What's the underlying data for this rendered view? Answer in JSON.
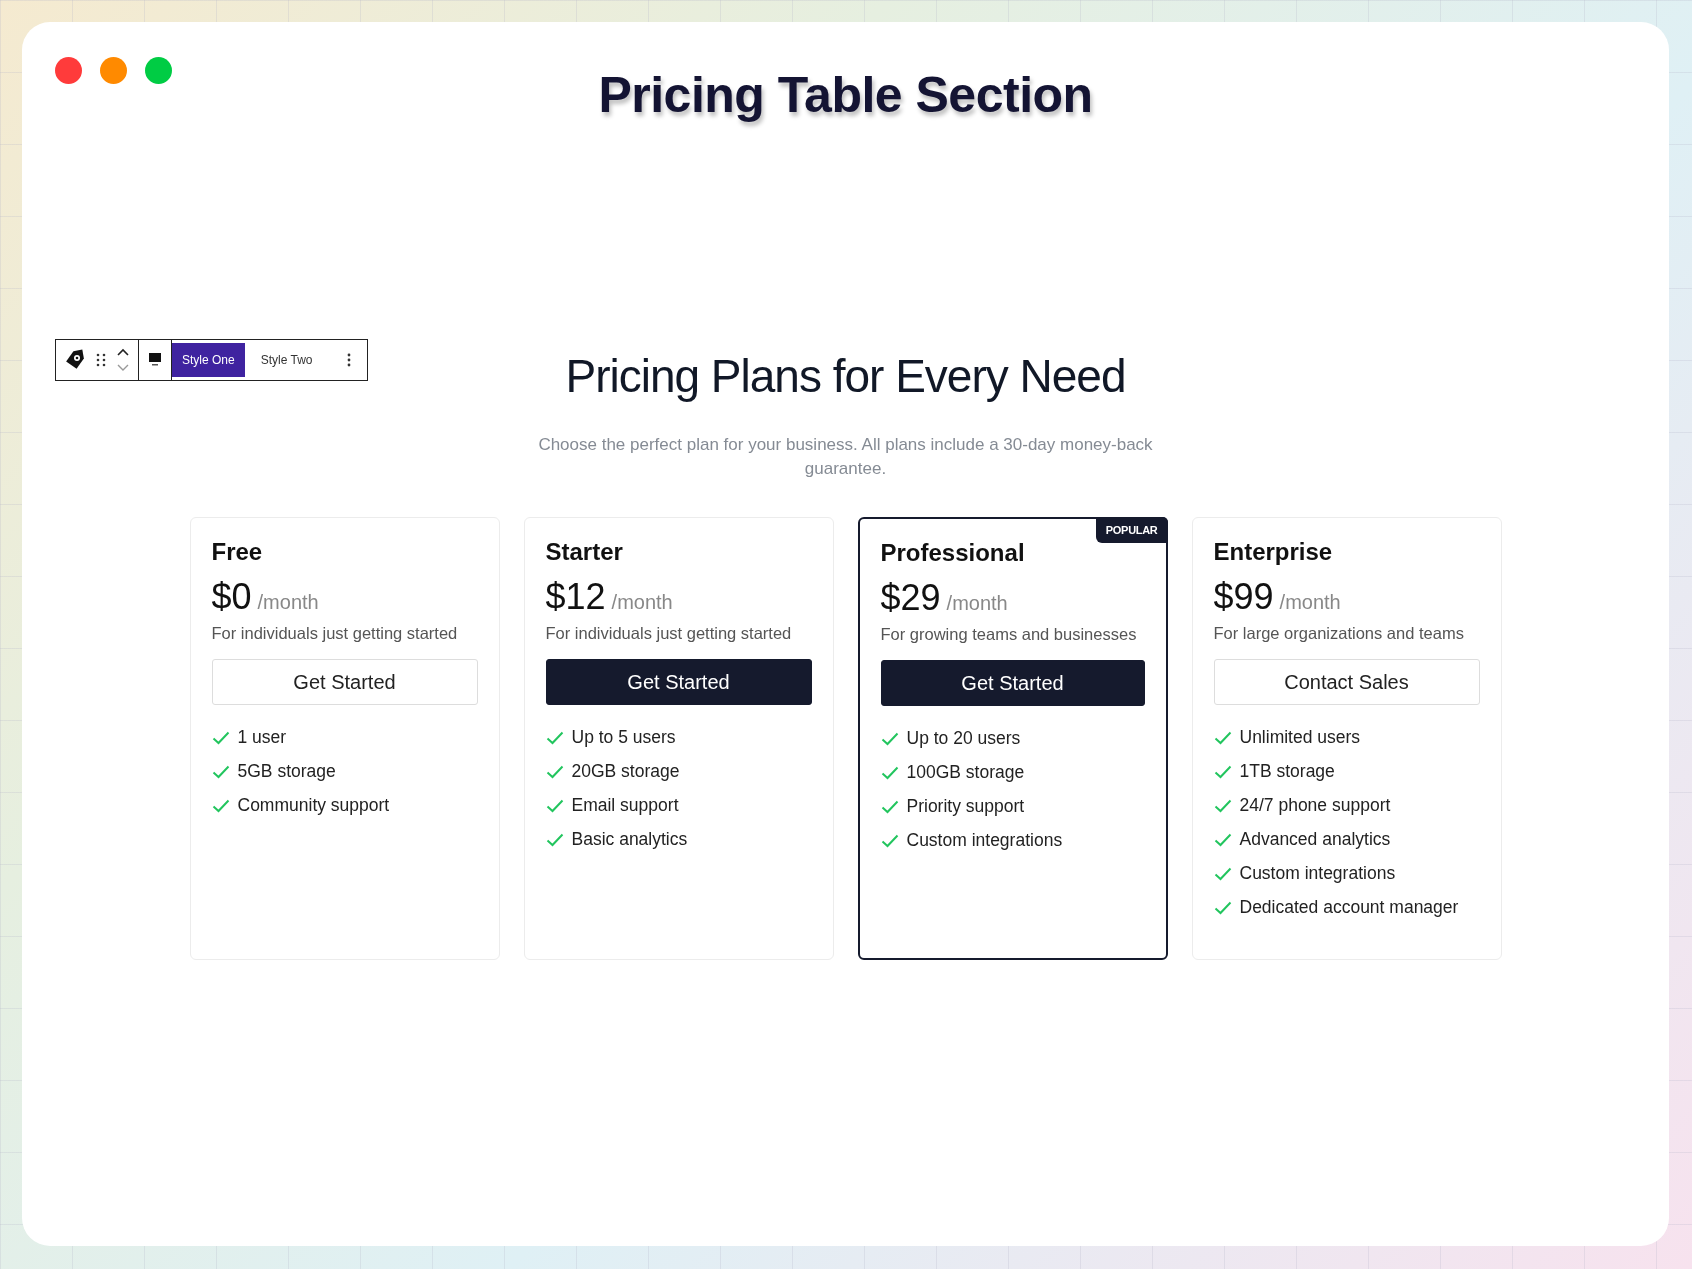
{
  "window": {
    "title": "Pricing Table Section",
    "controls": [
      {
        "color": "#ff3b3b"
      },
      {
        "color": "#ff8a00"
      },
      {
        "color": "#00cc44"
      }
    ]
  },
  "toolbar": {
    "tabs": [
      {
        "label": "Style One",
        "selected": true
      },
      {
        "label": "Style Two",
        "selected": false
      }
    ]
  },
  "section": {
    "heading": "Pricing Plans for Every Need",
    "subtitle": "Choose the perfect plan for your business. All plans include a 30-day money-back guarantee."
  },
  "plans": [
    {
      "name": "Free",
      "price": "$0",
      "period": "/month",
      "description": "For individuals just getting started",
      "button": {
        "label": "Get Started",
        "kind": "outline"
      },
      "highlighted": false,
      "features": [
        "1 user",
        "5GB storage",
        "Community support"
      ]
    },
    {
      "name": "Starter",
      "price": "$12",
      "period": "/month",
      "description": "For individuals just getting started",
      "button": {
        "label": "Get Started",
        "kind": "primary"
      },
      "highlighted": false,
      "features": [
        "Up to 5 users",
        "20GB storage",
        "Email support",
        "Basic analytics"
      ]
    },
    {
      "name": "Professional",
      "price": "$29",
      "period": "/month",
      "description": "For growing teams and businesses",
      "button": {
        "label": "Get Started",
        "kind": "primary"
      },
      "highlighted": true,
      "badge": "POPULAR",
      "features": [
        "Up to 20 users",
        "100GB storage",
        "Priority support",
        "Custom integrations"
      ]
    },
    {
      "name": "Enterprise",
      "price": "$99",
      "period": "/month",
      "description": "For large organizations and teams",
      "button": {
        "label": "Contact Sales",
        "kind": "outline"
      },
      "highlighted": false,
      "features": [
        "Unlimited users",
        "1TB storage",
        "24/7 phone support",
        "Advanced analytics",
        "Custom integrations",
        "Dedicated account manager"
      ]
    }
  ]
}
